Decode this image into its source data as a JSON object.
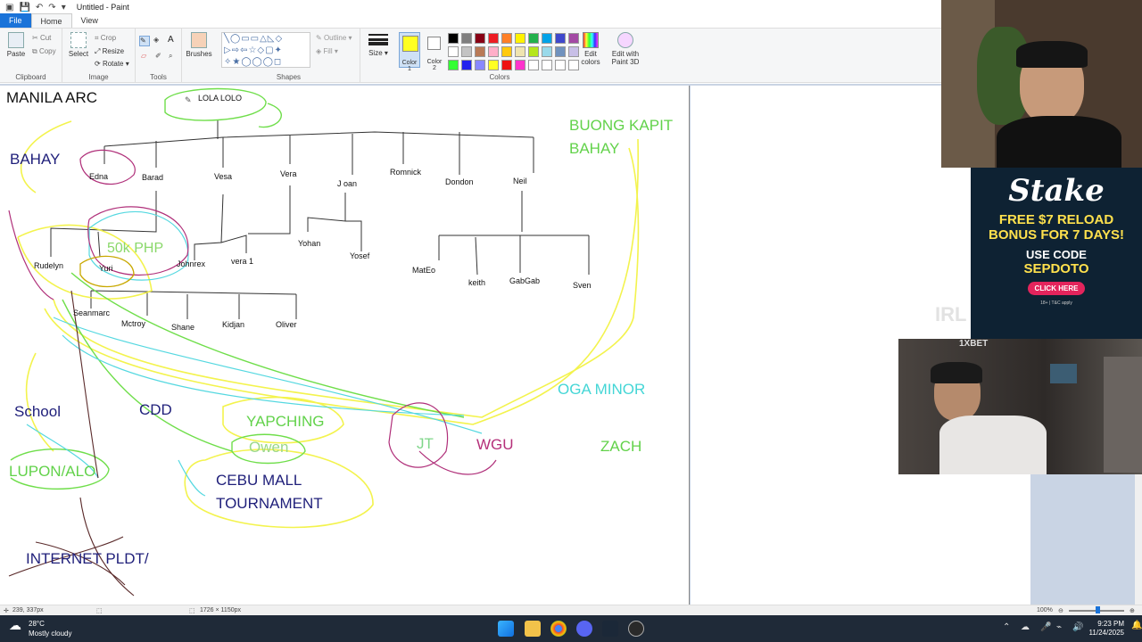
{
  "window": {
    "title": "Untitled - Paint"
  },
  "tabs": [
    "File",
    "Home",
    "View"
  ],
  "ribbon": {
    "clipboard": {
      "paste": "Paste",
      "cut": "Cut",
      "copy": "Copy",
      "label": "Clipboard"
    },
    "image": {
      "select": "Select",
      "crop": "Crop",
      "resize": "Resize",
      "rotate": "Rotate",
      "label": "Image"
    },
    "tools": {
      "label": "Tools"
    },
    "brushes": "Brushes",
    "shapes": {
      "outline": "Outline",
      "fill": "Fill",
      "label": "Shapes"
    },
    "size": "Size",
    "colors": {
      "color1": "Color 1",
      "color2": "Color 2",
      "edit_colors": "Edit colors",
      "label": "Colors",
      "palette_row1": [
        "#000000",
        "#7f7f7f",
        "#880015",
        "#ed1c24",
        "#ff7f27",
        "#fff200",
        "#22b14c",
        "#00a2e8",
        "#3f48cc",
        "#a349a4"
      ],
      "palette_row2": [
        "#ffffff",
        "#c3c3c3",
        "#b97a57",
        "#ffaec9",
        "#ffc90e",
        "#efe4b0",
        "#b5e61d",
        "#99d9ea",
        "#7092be",
        "#c8bfe7"
      ],
      "palette_row3": [
        "#33ff33",
        "#2222ee",
        "#8888ff",
        "#ffff22",
        "#ee1111",
        "#ff33cc",
        "#ffffff",
        "#ffffff",
        "#ffffff",
        "#ffffff"
      ]
    },
    "paint3d": "Edit with Paint 3D"
  },
  "canvas": {
    "title": "MANILA ARC",
    "root": "LOLA LOLO",
    "level1": [
      "Edna",
      "Barad",
      "Vesa",
      "Vera",
      "J oan",
      "Romnick",
      "Dondon",
      "Neil"
    ],
    "vesa_children": [
      "Johnrex",
      "vera 1"
    ],
    "vera_children": [
      "Yohan",
      "Yosef"
    ],
    "neil_children": [
      "MatEo",
      "keith",
      "GabGab",
      "Sven"
    ],
    "barad_children": [
      "Rudelyn",
      "Yuri"
    ],
    "yuri_children": [
      "Seanmarc",
      "Mctroy",
      "Shane",
      "Kidjan",
      "Oliver"
    ],
    "money": "50k PHP",
    "labels": {
      "bahay": "BAHAY",
      "buong_kapit_1": "BUONG KAPIT",
      "buong_kapit_2": "BAHAY",
      "oga_minor": "OGA MINOR",
      "school": "School",
      "cdd": "CDD",
      "yapching": "YAPCHING",
      "owen": "Owen",
      "jt": "JT",
      "wgu": "WGU",
      "zach": "ZACH",
      "lupon": "LUPON/ALO",
      "cebu_1": "CEBU MALL",
      "cebu_2": "TOURNAMENT",
      "internet": "INTERNET PLDT/"
    }
  },
  "status": {
    "cursor": "239, 337px",
    "size": "1726 × 1150px",
    "zoom": "100%"
  },
  "taskbar": {
    "temp": "28°C",
    "weather": "Mostly cloudy",
    "time": "9:23 PM",
    "date": "11/24/2025"
  },
  "ad": {
    "brand": "Stake",
    "offer_1": "FREE $7 RELOAD",
    "offer_2": "BONUS FOR 7 DAYS!",
    "use_code": "USE CODE",
    "code": "SEPDOTO",
    "cta": "CLICK HERE",
    "fine": "18+ | T&C apply"
  },
  "overlay_text": "IRL",
  "cam2_sponsor": "1XBET"
}
